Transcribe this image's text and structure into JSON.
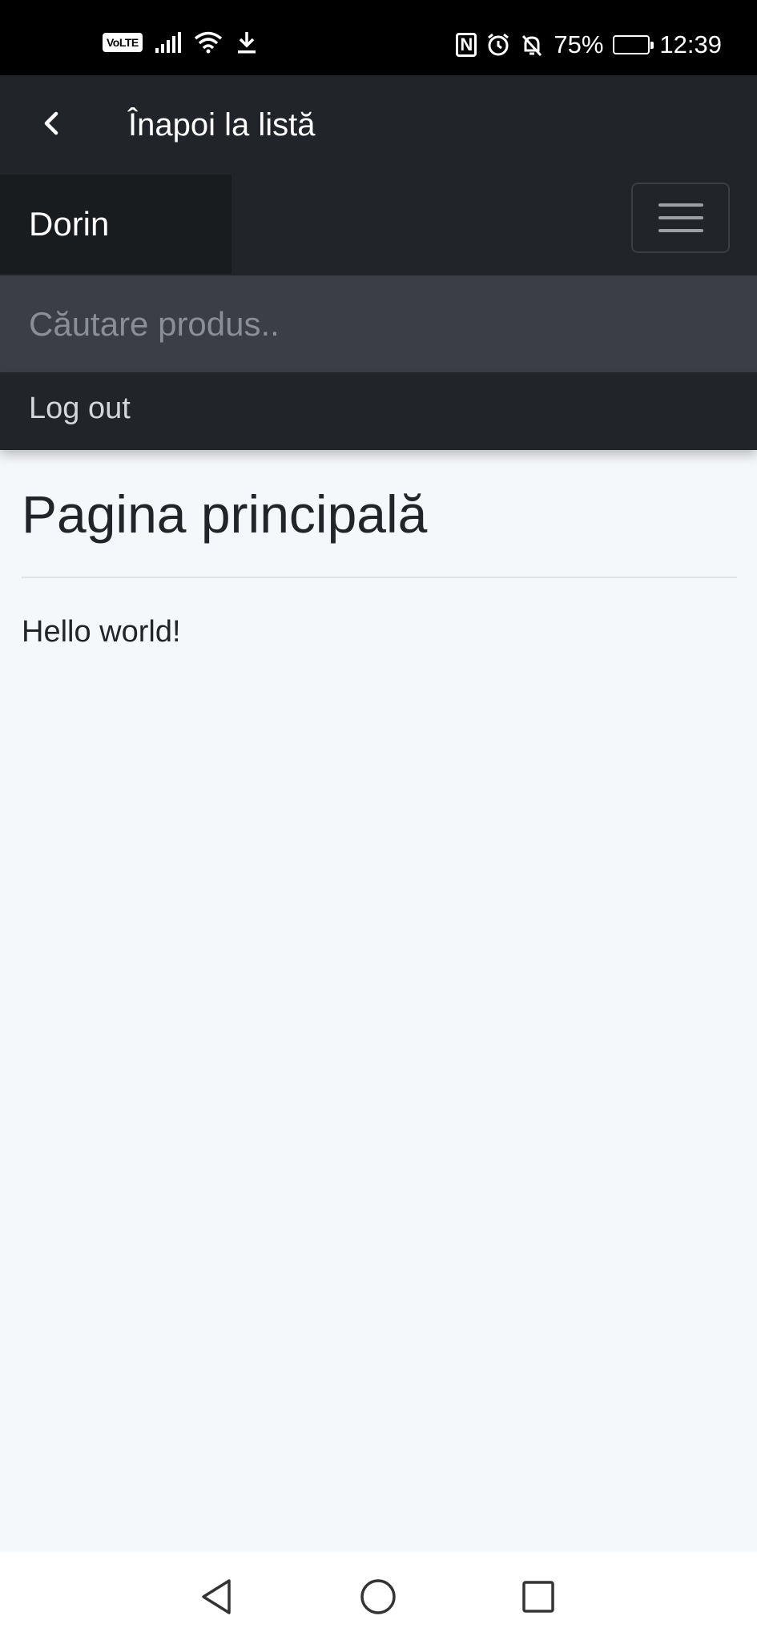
{
  "status_bar": {
    "volte": "VoLTE",
    "battery_percent": "75%",
    "battery_level": 0.75,
    "time": "12:39",
    "nfc_label": "N"
  },
  "header": {
    "back_icon": "chevron-left-icon",
    "title": "Înapoi la listă"
  },
  "navbar": {
    "brand": "Dorin",
    "menu_icon": "hamburger-icon"
  },
  "search": {
    "placeholder": "Căutare produs..",
    "value": ""
  },
  "menu": {
    "logout": "Log out"
  },
  "main": {
    "title": "Pagina principală",
    "body": "Hello world!"
  },
  "colors": {
    "header_bg": "#212529",
    "brand_bg": "#191c1f",
    "search_bg": "#3b3f45",
    "page_bg": "#f5f8fb"
  }
}
